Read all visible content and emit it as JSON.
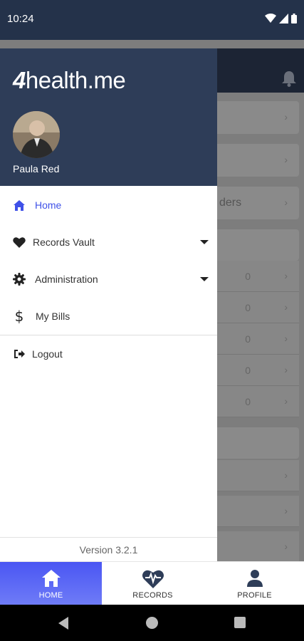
{
  "status_bar": {
    "time": "10:24"
  },
  "background": {
    "partial_text": "ders",
    "zero_values": [
      "0",
      "0",
      "0",
      "0",
      "0"
    ]
  },
  "drawer": {
    "logo_prefix": "4",
    "logo_text": "health.me",
    "user_name": "Paula Red",
    "menu": [
      {
        "label": "Home",
        "icon": "home-icon",
        "active": true
      },
      {
        "label": "Records Vault",
        "icon": "heart-icon",
        "expandable": true
      },
      {
        "label": "Administration",
        "icon": "gear-icon",
        "expandable": true
      },
      {
        "label": "My Bills",
        "icon": "dollar-icon"
      }
    ],
    "logout": {
      "label": "Logout",
      "icon": "logout-icon"
    },
    "version": "Version 3.2.1"
  },
  "bottom_nav": [
    {
      "label": "HOME",
      "icon": "home-icon",
      "active": true
    },
    {
      "label": "RECORDS",
      "icon": "heart-pulse-icon"
    },
    {
      "label": "PROFILE",
      "icon": "person-icon"
    }
  ],
  "colors": {
    "drawer_header": "#2e3d58",
    "accent": "#3f51e8",
    "nav_active": "#4a56f3"
  }
}
